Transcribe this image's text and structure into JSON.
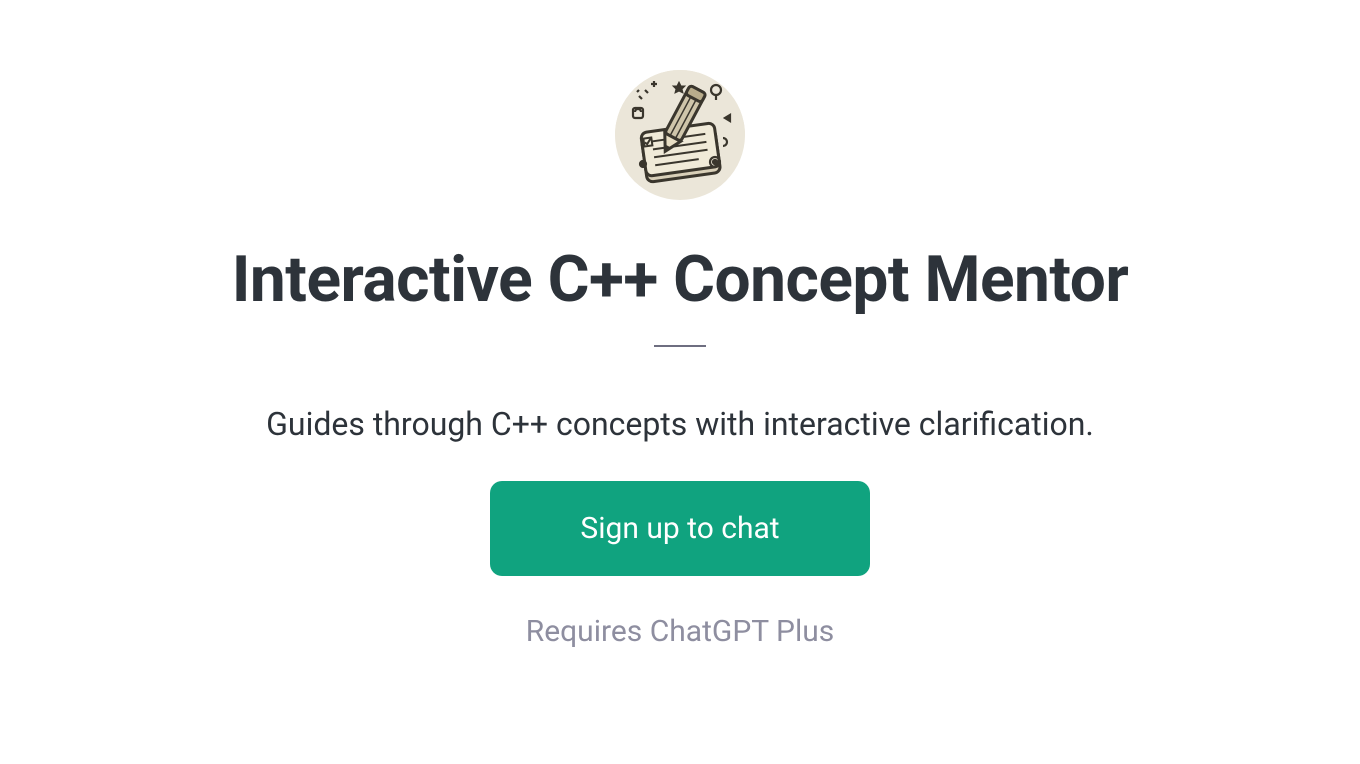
{
  "page": {
    "title": "Interactive C++ Concept Mentor",
    "subtitle": "Guides through C++ concepts with interactive clarification.",
    "cta_label": "Sign up to chat",
    "note": "Requires ChatGPT Plus"
  },
  "colors": {
    "accent": "#10a37f",
    "text_primary": "#2d333a",
    "text_muted": "#8e8ea0",
    "avatar_bg": "#ebe6d9"
  },
  "icon": {
    "name": "notebook-pencil-icon"
  }
}
